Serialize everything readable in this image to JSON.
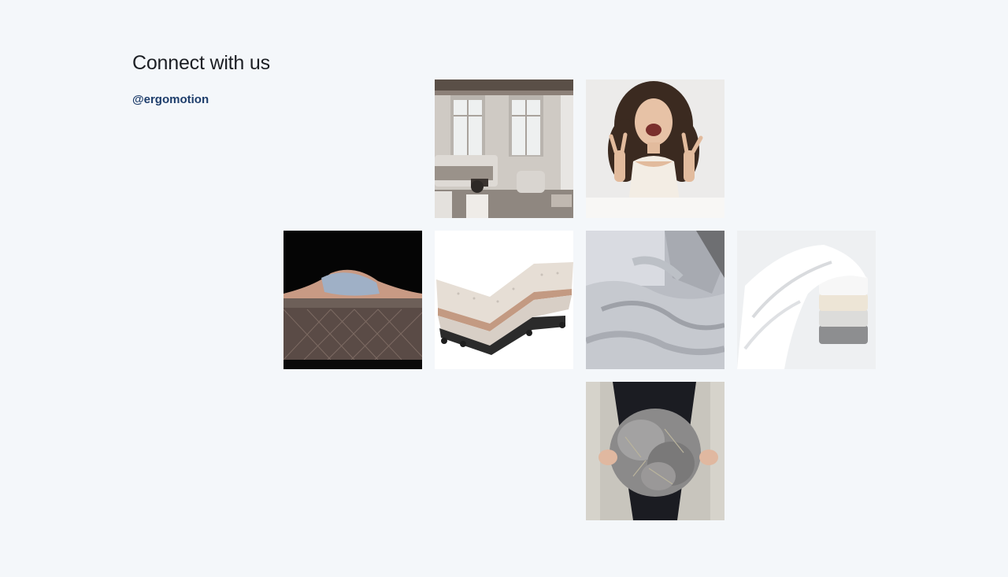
{
  "section": {
    "title": "Connect with us",
    "handle": "@ergomotion"
  },
  "gallery": {
    "posts": [
      {
        "subject": "bedroom-interior-photo"
      },
      {
        "subject": "smiling-woman-photo"
      },
      {
        "subject": "mattress-closeup-photo"
      },
      {
        "subject": "adjustable-bed-photo"
      },
      {
        "subject": "grey-bedding-photo"
      },
      {
        "subject": "folded-sheets-photo"
      },
      {
        "subject": "wool-fiber-photo"
      }
    ]
  }
}
